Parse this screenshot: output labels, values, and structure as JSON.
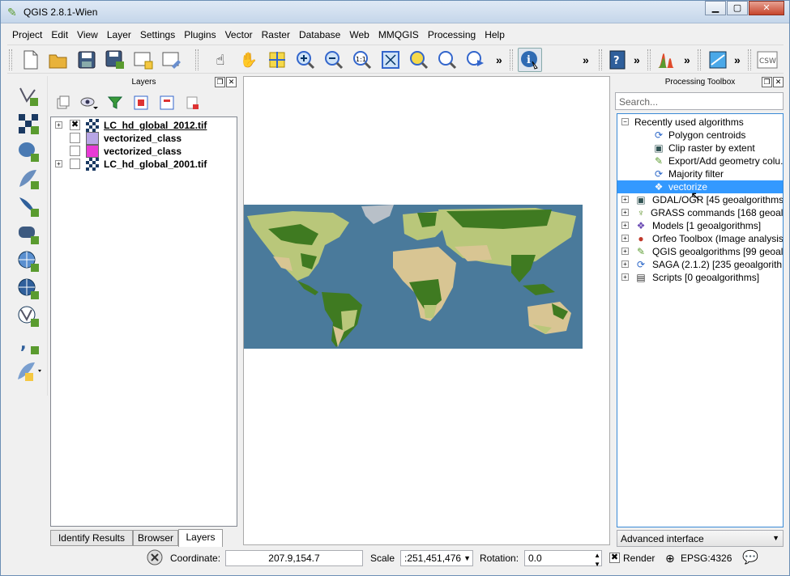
{
  "window": {
    "title": "QGIS 2.8.1-Wien",
    "minimize": "▁",
    "maximize": "▢",
    "close": "✕"
  },
  "menu": [
    "Project",
    "Edit",
    "View",
    "Layer",
    "Settings",
    "Plugins",
    "Vector",
    "Raster",
    "Database",
    "Web",
    "MMQGIS",
    "Processing",
    "Help"
  ],
  "toolbar": {
    "more": "»",
    "csw": "CSW"
  },
  "layers_panel": {
    "title": "Layers",
    "layers": [
      {
        "name": "LC_hd_global_2012.tif",
        "checked": true,
        "expanded": true,
        "swatch": "raster"
      },
      {
        "name": "vectorized_class",
        "checked": false,
        "expanded": false,
        "swatch": "#b8a6e6"
      },
      {
        "name": "vectorized_class",
        "checked": false,
        "expanded": false,
        "swatch": "#e83ad6"
      },
      {
        "name": "LC_hd_global_2001.tif",
        "checked": false,
        "expanded": true,
        "swatch": "raster"
      }
    ],
    "tabs": [
      "Identify Results",
      "Browser",
      "Layers"
    ]
  },
  "toolbox": {
    "title": "Processing Toolbox",
    "search_placeholder": "Search...",
    "recent": "Recently used algorithms",
    "recent_items": [
      "Polygon centroids",
      "Clip raster by extent",
      "Export/Add geometry colu...",
      "Majority filter",
      "vectorize"
    ],
    "providers": [
      "GDAL/OGR [45 geoalgorithms]",
      "GRASS commands [168 geoalg...",
      "Models [1 geoalgorithms]",
      "Orfeo Toolbox (Image analysis...",
      "QGIS geoalgorithms [99 geoal...",
      "SAGA (2.1.2) [235 geoalgorith...",
      "Scripts [0 geoalgorithms]"
    ],
    "mode": "Advanced interface"
  },
  "statusbar": {
    "coordinate_label": "Coordinate:",
    "coordinate": "207.9,154.7",
    "scale_label": "Scale",
    "scale": ":251,451,476",
    "rotation_label": "Rotation:",
    "rotation": "0.0",
    "render_label": "Render",
    "crs": "EPSG:4326"
  },
  "colors": {
    "ocean": "#4a7a9b",
    "forest": "#3f7a21",
    "cropland": "#b9c77a",
    "desert": "#d8c593",
    "ice": "#b8c0c8"
  }
}
